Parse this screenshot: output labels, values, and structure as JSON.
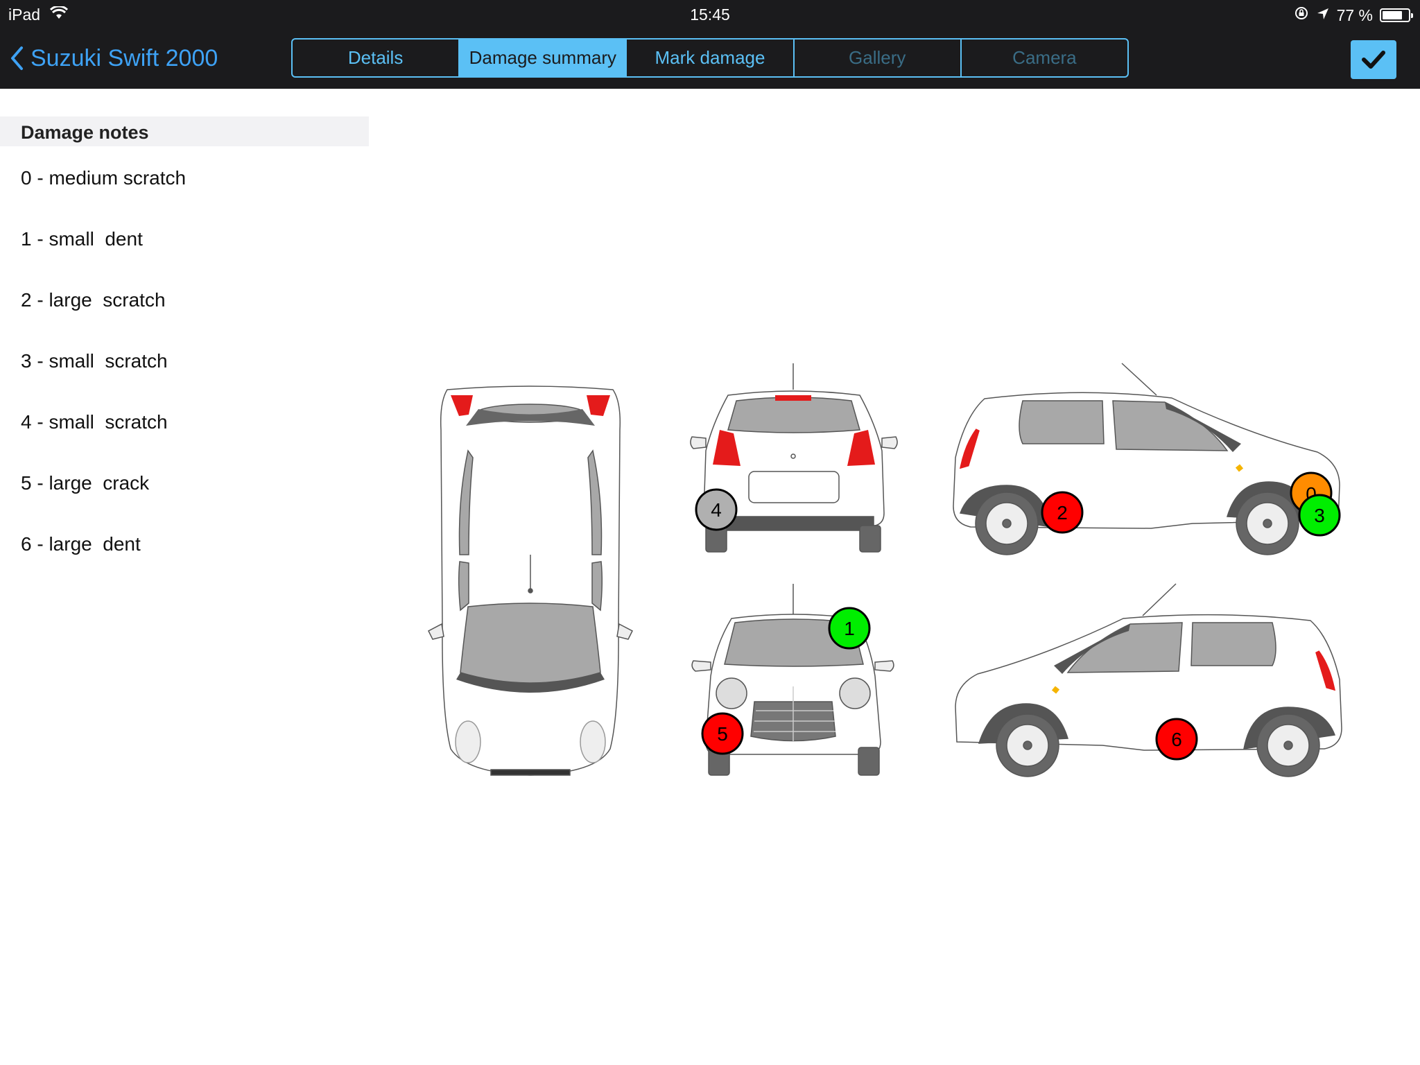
{
  "status_bar": {
    "device": "iPad",
    "time": "15:45",
    "battery_text": "77 %",
    "battery_level": 0.77
  },
  "nav": {
    "back_label": "Suzuki Swift 2000",
    "tabs": [
      {
        "label": "Details",
        "state": "enabled"
      },
      {
        "label": "Damage summary",
        "state": "active"
      },
      {
        "label": "Mark damage",
        "state": "enabled"
      },
      {
        "label": "Gallery",
        "state": "disabled"
      },
      {
        "label": "Camera",
        "state": "disabled"
      }
    ],
    "done_icon": "checkmark-icon"
  },
  "damage_notes": {
    "title": "Damage notes",
    "items": [
      {
        "label": "0 - medium scratch"
      },
      {
        "label": "1 - small  dent"
      },
      {
        "label": "2 - large  scratch"
      },
      {
        "label": "3 - small  scratch"
      },
      {
        "label": "4 - small  scratch"
      },
      {
        "label": "5 - large  crack"
      },
      {
        "label": "6 - large  dent"
      }
    ]
  },
  "markers": [
    {
      "label": "0",
      "color": "#ff8c00"
    },
    {
      "label": "1",
      "color": "#00ee00"
    },
    {
      "label": "2",
      "color": "#ff0000"
    },
    {
      "label": "3",
      "color": "#00ee00"
    },
    {
      "label": "4",
      "color": "#b0b0b0"
    },
    {
      "label": "5",
      "color": "#ff0000"
    },
    {
      "label": "6",
      "color": "#ff0000"
    }
  ],
  "colors": {
    "accent": "#5bc0f5",
    "bar": "#1b1b1d",
    "window": "#a8a8a8",
    "tail_light": "#e41b1b"
  }
}
